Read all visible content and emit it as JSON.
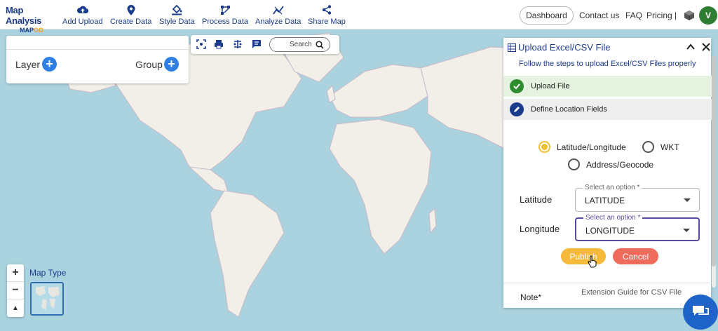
{
  "header": {
    "logo_line1": "Map Analysis",
    "logo_line2_a": "MAP",
    "logo_line2_b": "OG",
    "nav": [
      {
        "label": "Add Upload",
        "icon": "cloud-upload-icon"
      },
      {
        "label": "Create Data",
        "icon": "location-pin-icon"
      },
      {
        "label": "Style Data",
        "icon": "paint-bucket-icon"
      },
      {
        "label": "Process Data",
        "icon": "process-nodes-icon"
      },
      {
        "label": "Analyze Data",
        "icon": "analyze-icon"
      },
      {
        "label": "Share Map",
        "icon": "share-icon"
      }
    ],
    "dashboard": "Dashboard",
    "contact": "Contact us",
    "faq": "FAQ",
    "pricing": "Pricing |",
    "avatar": "V"
  },
  "layer_panel": {
    "layer_label": "Layer",
    "group_label": "Group"
  },
  "map_tools": {
    "search_label": "Search"
  },
  "map_controls": {
    "zoom_in": "+",
    "zoom_out": "−",
    "reset_north": "▲",
    "map_type_label": "Map Type"
  },
  "upload_panel": {
    "title": "Upload Excel/CSV File",
    "subtitle": "Follow the steps to upload Excel/CSV Files properly",
    "step1": "Upload File",
    "step2": "Define Location Fields",
    "options": [
      "Latitude/Longitude",
      "WKT",
      "Address/Geocode"
    ],
    "selected_option": "Latitude/Longitude",
    "latitude_label": "Latitude",
    "longitude_label": "Longitude",
    "select_legend": "Select an option *",
    "latitude_value": "LATITUDE",
    "longitude_value": "LONGITUDE",
    "publish": "Publish",
    "cancel": "Cancel",
    "note_label": "Note*",
    "note_text": "Extension Guide for CSV File"
  },
  "colors": {
    "brand": "#1b3b8c",
    "accent": "#f2c12e",
    "step_done": "#2e8b2e",
    "publish": "#f6b93b",
    "cancel": "#ef6b5b"
  }
}
